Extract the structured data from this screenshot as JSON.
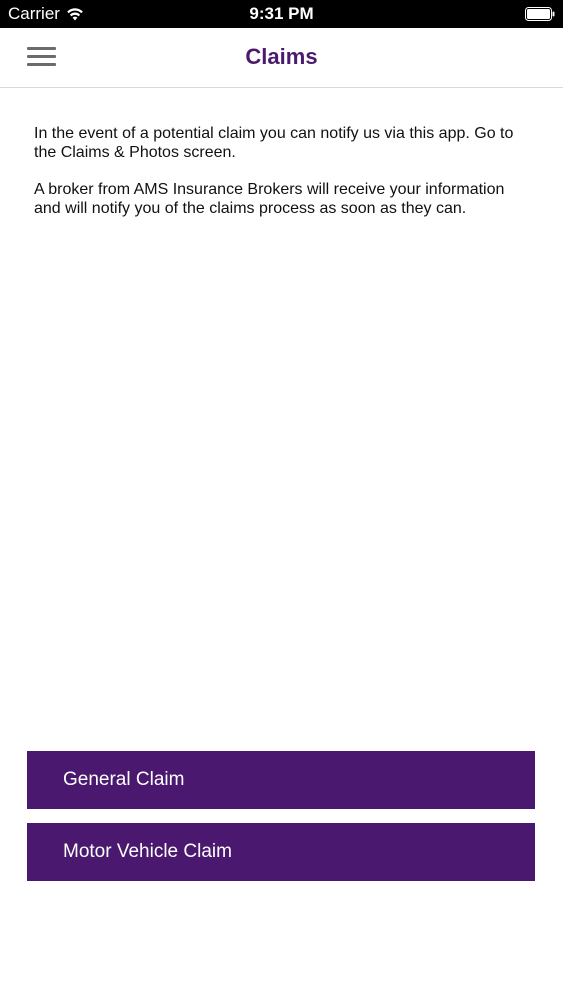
{
  "status_bar": {
    "carrier": "Carrier",
    "time": "9:31 PM",
    "wifi_icon": "wifi-icon",
    "battery_icon": "battery-icon"
  },
  "nav": {
    "title": "Claims",
    "menu_icon": "hamburger-menu-icon"
  },
  "content": {
    "paragraph_1": "In the event of a potential claim you can notify us via this app. Go to the Claims & Photos screen.",
    "paragraph_2": "A broker from AMS Insurance Brokers will receive your information and will notify you of the claims process as soon as they can."
  },
  "buttons": {
    "general_claim": "General Claim",
    "motor_vehicle_claim": "Motor Vehicle Claim"
  },
  "colors": {
    "brand_purple": "#4a186e",
    "title_purple": "#4a1a6e",
    "status_bar_bg": "#000000"
  }
}
